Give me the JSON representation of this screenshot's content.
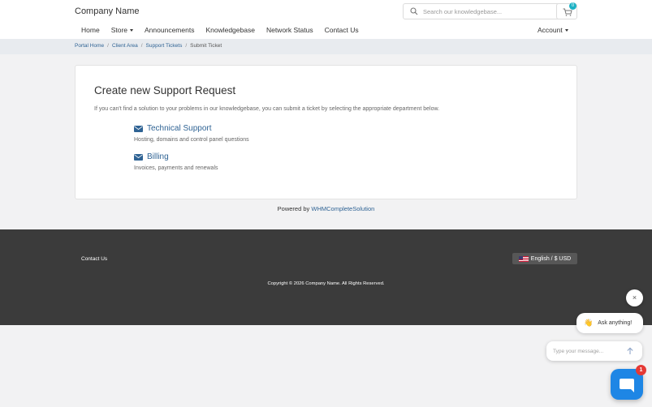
{
  "header": {
    "brand": "Company Name",
    "search_placeholder": "Search our knowledgebase...",
    "cart_count": "0",
    "nav": [
      {
        "label": "Home",
        "dropdown": false
      },
      {
        "label": "Store",
        "dropdown": true
      },
      {
        "label": "Announcements",
        "dropdown": false
      },
      {
        "label": "Knowledgebase",
        "dropdown": false
      },
      {
        "label": "Network Status",
        "dropdown": false
      },
      {
        "label": "Contact Us",
        "dropdown": false
      }
    ],
    "account_label": "Account"
  },
  "breadcrumb": {
    "items": [
      "Portal Home",
      "Client Area",
      "Support Tickets"
    ],
    "current": "Submit Ticket"
  },
  "main": {
    "title": "Create new Support Request",
    "intro": "If you can't find a solution to your problems in our knowledgebase, you can submit a ticket by selecting the appropriate department below.",
    "departments": [
      {
        "name": "Technical Support",
        "description": "Hosting, domains and control panel questions"
      },
      {
        "name": "Billing",
        "description": "Invoices, payments and renewals"
      }
    ]
  },
  "powered": {
    "prefix": "Powered by",
    "link": "WHMCompleteSolution"
  },
  "footer": {
    "contact": "Contact Us",
    "language": "English / $ USD",
    "copyright": "Copyright © 2026 Company Name. All Rights Reserved."
  },
  "chat": {
    "close_symbol": "×",
    "emoji": "👋",
    "prompt": "Ask anything!",
    "input_placeholder": "Type your message...",
    "unread": "1"
  },
  "colors": {
    "link": "#2f6394",
    "footer_bg": "#3b3b3b",
    "chat_accent": "#1e86e5",
    "cart_badge": "#1bb1c4"
  }
}
